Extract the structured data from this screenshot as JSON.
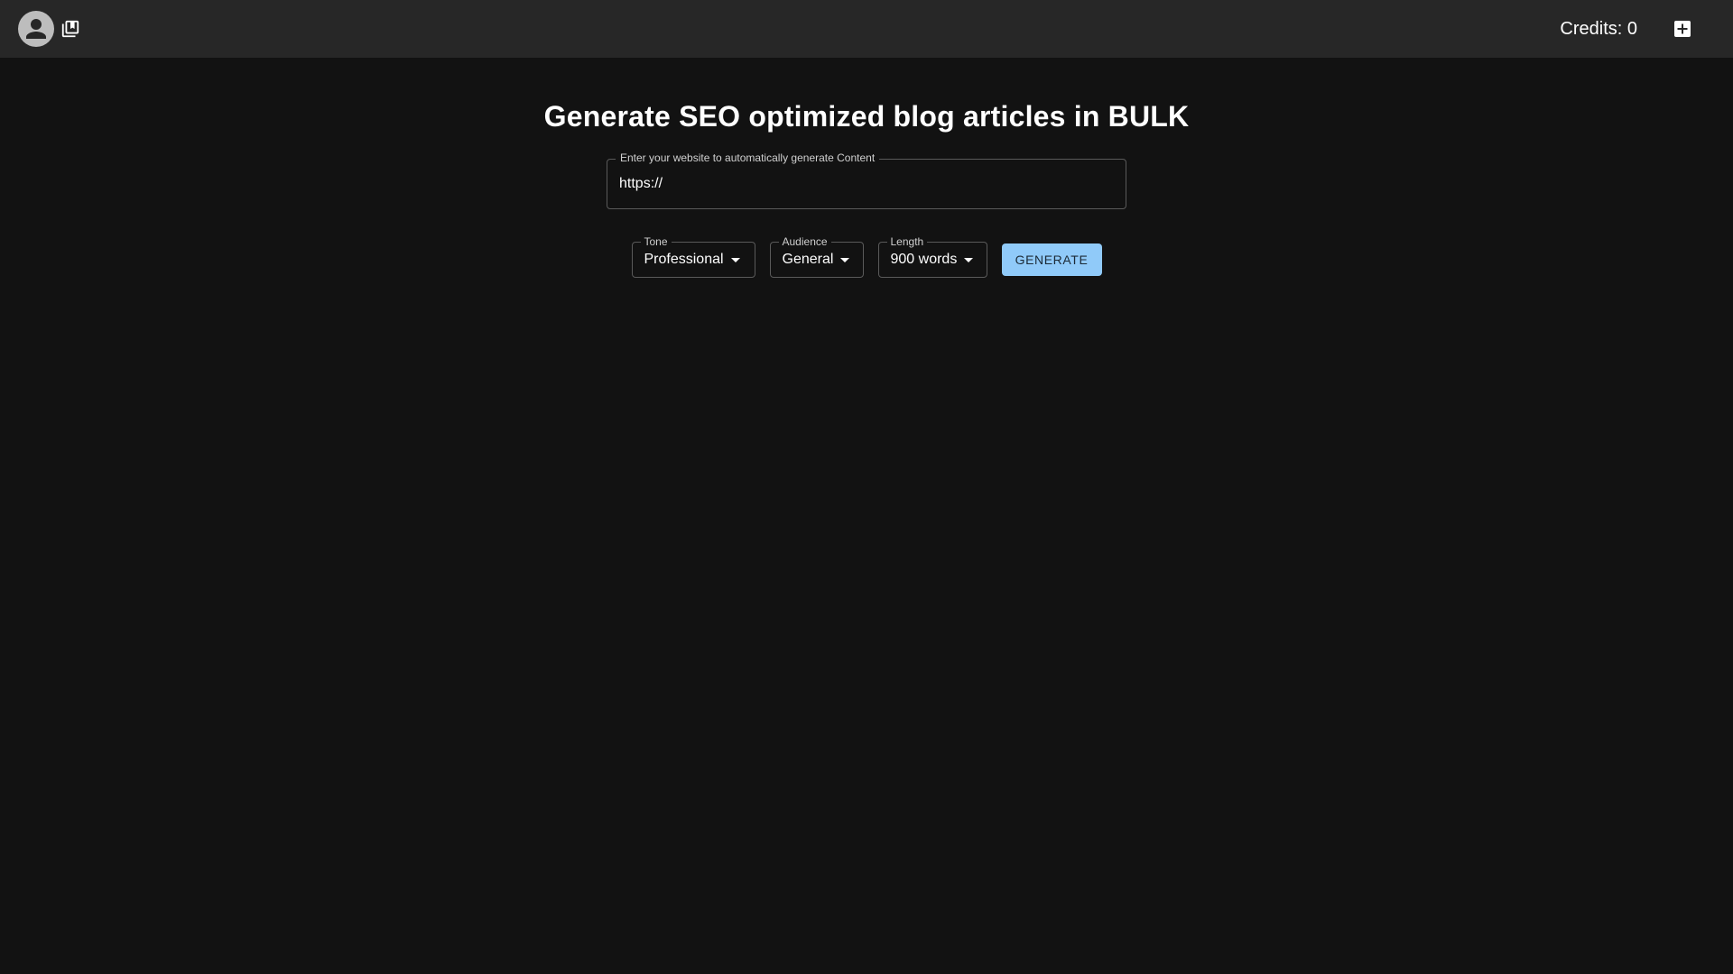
{
  "header": {
    "credits_label": "Credits: 0",
    "icons": {
      "avatar": "account-circle-icon",
      "library": "library-books-icon",
      "add": "add-box-icon"
    }
  },
  "main": {
    "title": "Generate SEO optimized blog articles in BULK",
    "url_field": {
      "label": "Enter your website to automatically generate Content",
      "value": "https://"
    },
    "selects": {
      "tone": {
        "label": "Tone",
        "value": "Professional"
      },
      "audience": {
        "label": "Audience",
        "value": "General"
      },
      "length": {
        "label": "Length",
        "value": "900 words"
      }
    },
    "generate_label": "GENERATE"
  },
  "colors": {
    "topbar": "#272727",
    "background": "#121212",
    "primary_button": "#90caf9"
  }
}
